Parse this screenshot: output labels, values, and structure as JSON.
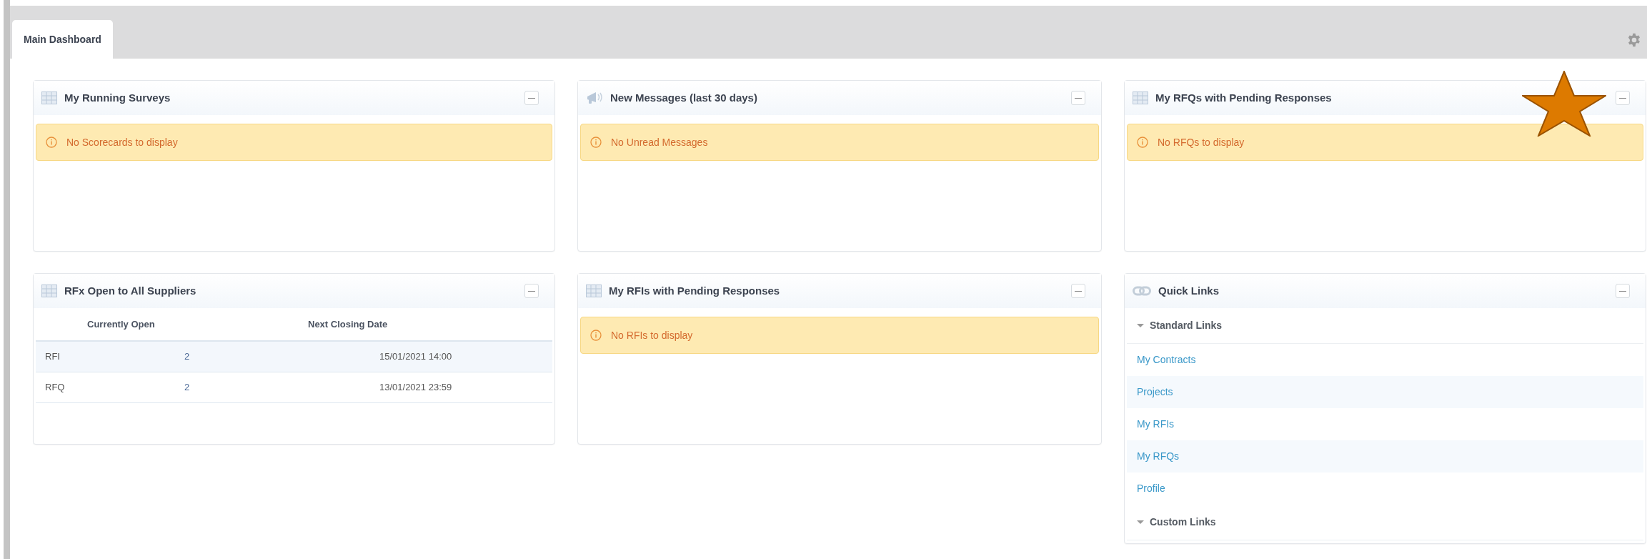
{
  "tabs": [
    {
      "label": "Main Dashboard",
      "selected": true
    }
  ],
  "widgets": [
    {
      "kind": "alert",
      "title": "My Running Surveys",
      "message": "No Scorecards to display"
    },
    {
      "kind": "alert",
      "title": "New Messages (last 30 days)",
      "message": "No Unread Messages"
    },
    {
      "kind": "alert",
      "title": "My RFQs with Pending Responses",
      "message": "No RFQs to display"
    },
    {
      "kind": "table",
      "title": "RFx Open to All Suppliers",
      "columns": [
        "Currently Open",
        "Next Closing Date"
      ],
      "rows": [
        {
          "cells": [
            "RFI",
            "2",
            "15/01/2021 14:00"
          ],
          "highlighted": true
        },
        {
          "cells": [
            "RFQ",
            "2",
            "13/01/2021 23:59"
          ],
          "highlighted": false
        }
      ]
    },
    {
      "kind": "alert",
      "title": "My RFIs with Pending Responses",
      "message": "No RFIs to display"
    },
    {
      "kind": "links",
      "title": "Quick Links",
      "sections": [
        {
          "title": "Standard Links",
          "expanded": true,
          "links": [
            "My Contracts",
            "Projects",
            "My RFIs",
            "My RFQs",
            "Profile"
          ]
        },
        {
          "title": "Custom Links",
          "expanded": true
        }
      ]
    }
  ]
}
